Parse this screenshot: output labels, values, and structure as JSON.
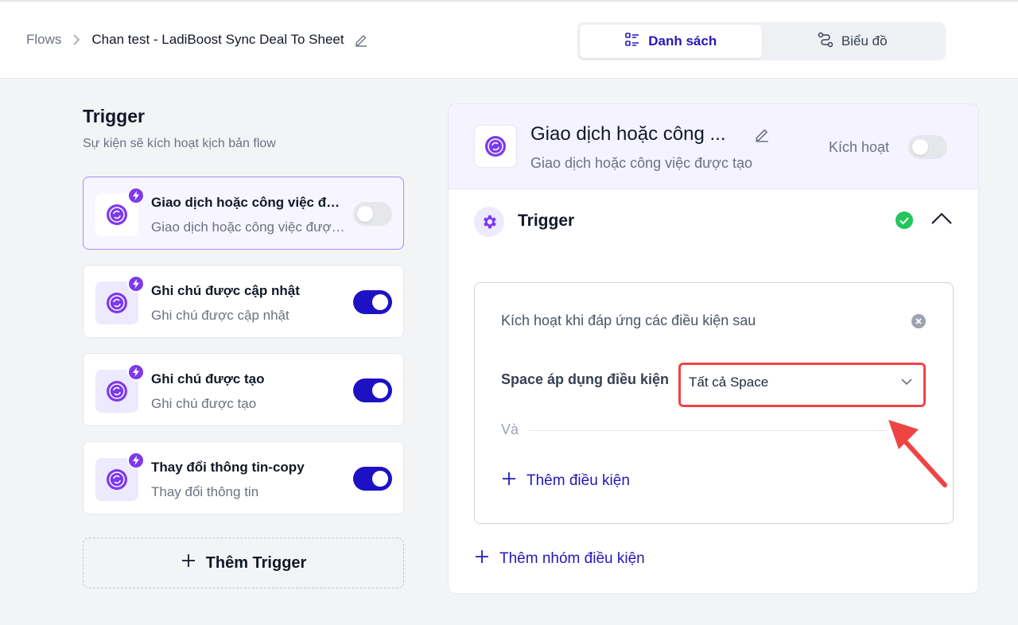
{
  "breadcrumb": {
    "root": "Flows",
    "current": "Chan test - LadiBoost Sync Deal To Sheet"
  },
  "view_toggle": {
    "list_label": "Danh sách",
    "chart_label": "Biểu đồ",
    "active": "list"
  },
  "left": {
    "title": "Trigger",
    "subtitle": "Sự kiện sẽ kích hoạt kịch bản flow",
    "triggers": [
      {
        "title": "Giao dịch hoặc công việc được tạo",
        "subtitle": "Giao dịch hoặc công việc được tạo",
        "enabled": false,
        "selected": true
      },
      {
        "title": "Ghi chú được cập nhật",
        "subtitle": "Ghi chú được cập nhật",
        "enabled": true,
        "selected": false
      },
      {
        "title": "Ghi chú được tạo",
        "subtitle": "Ghi chú được tạo",
        "enabled": true,
        "selected": false
      },
      {
        "title": "Thay đổi thông tin-copy",
        "subtitle": "Thay đổi thông tin",
        "enabled": true,
        "selected": false
      }
    ],
    "add_trigger_label": "Thêm Trigger"
  },
  "detail": {
    "title": "Giao dịch hoặc công ...",
    "subtitle": "Giao dịch hoặc công việc được tạo",
    "active_label": "Kích hoạt",
    "active": false,
    "section_title": "Trigger",
    "conditions": {
      "title": "Kích hoạt khi đáp ứng các điều kiện sau",
      "space_label": "Space áp dụng điều kiện",
      "space_value": "Tất cả Space",
      "and_label": "Và",
      "add_condition_label": "Thêm điều kiện"
    },
    "add_group_label": "Thêm nhóm điều kiện"
  },
  "colors": {
    "primary": "#1d11c4",
    "primary_text": "#2617b8",
    "accent_purple": "#7c3aed",
    "success": "#22c55e",
    "highlight_red": "#ef4444"
  },
  "icons": {
    "trigger": "purple-coin-sync-icon",
    "badge": "lightning-bolt-icon",
    "section": "gear-icon",
    "status": "check-circle-icon"
  }
}
